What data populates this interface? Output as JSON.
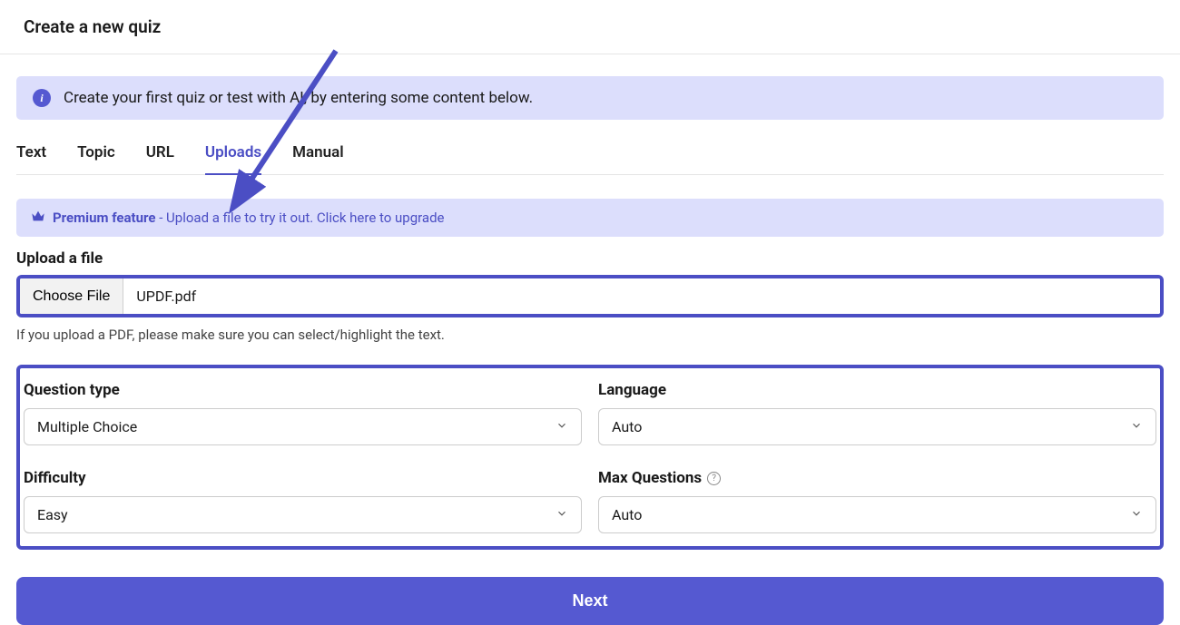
{
  "header": {
    "title": "Create a new quiz"
  },
  "info_banner": {
    "text": "Create your first quiz or test with AI, by entering some content below."
  },
  "tabs": [
    {
      "label": "Text",
      "active": false
    },
    {
      "label": "Topic",
      "active": false
    },
    {
      "label": "URL",
      "active": false
    },
    {
      "label": "Uploads",
      "active": true
    },
    {
      "label": "Manual",
      "active": false
    }
  ],
  "premium": {
    "strong": "Premium feature",
    "rest": " - Upload a file to try it out. Click here to upgrade"
  },
  "upload": {
    "label": "Upload a file",
    "choose_button": "Choose File",
    "file_name": "UPDF.pdf",
    "hint": "If you upload a PDF, please make sure you can select/highlight the text."
  },
  "options": {
    "question_type": {
      "label": "Question type",
      "value": "Multiple Choice"
    },
    "language": {
      "label": "Language",
      "value": "Auto"
    },
    "difficulty": {
      "label": "Difficulty",
      "value": "Easy"
    },
    "max_questions": {
      "label": "Max Questions",
      "value": "Auto"
    }
  },
  "next_button": "Next",
  "colors": {
    "accent": "#4b4ec4",
    "banner_bg": "#dcdefc"
  }
}
